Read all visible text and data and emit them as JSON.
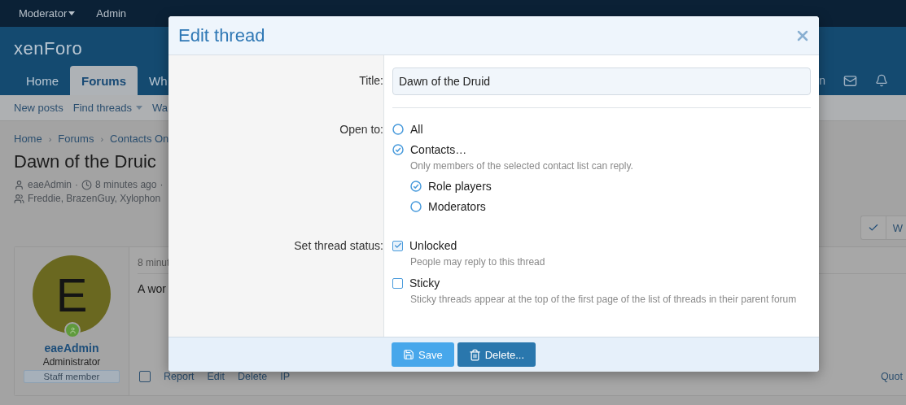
{
  "top_bar": {
    "items": [
      {
        "label": "Moderator",
        "dropdown": true
      },
      {
        "label": "Admin",
        "dropdown": false
      }
    ]
  },
  "header": {
    "logo": "xenForo",
    "tabs": [
      {
        "label": "Home",
        "selected": false
      },
      {
        "label": "Forums",
        "selected": true
      },
      {
        "label": "Wh",
        "selected": false
      }
    ],
    "right_label": "n"
  },
  "sub_nav": [
    {
      "label": "New posts",
      "dropdown": false
    },
    {
      "label": "Find threads",
      "dropdown": true
    },
    {
      "label": "Wa",
      "dropdown": false
    }
  ],
  "breadcrumb": {
    "separator": "›",
    "items": [
      "Home",
      "Forums",
      "Contacts On"
    ]
  },
  "thread": {
    "title": "Dawn of the Druic",
    "author": "eaeAdmin",
    "separator": "·",
    "time": "8 minutes ago",
    "trailing": "·",
    "participants": "Freddie, BrazenGuy, Xylophon",
    "action_label": "W"
  },
  "post": {
    "selected": false,
    "avatar_letter": "E",
    "username": "eaeAdmin",
    "role": "Administrator",
    "badge": "Staff member",
    "time": "8 minut",
    "body": "A wor",
    "actions": [
      "Report",
      "Edit",
      "Delete",
      "IP"
    ],
    "right_action": "Quot"
  },
  "modal": {
    "title": "Edit thread",
    "fields": [
      {
        "kind": "text",
        "label": "Title:",
        "value": "Dawn of the Druid"
      },
      {
        "kind": "radio",
        "label": "Open to:",
        "options": [
          {
            "label": "All",
            "selected": false
          },
          {
            "label": "Contacts…",
            "selected": true,
            "hint": "Only members of the selected contact list can reply.",
            "children": [
              {
                "label": "Role players",
                "selected": true
              },
              {
                "label": "Moderators",
                "selected": false
              }
            ]
          }
        ]
      },
      {
        "kind": "checkbox",
        "label": "Set thread status:",
        "options": [
          {
            "label": "Unlocked",
            "checked": true,
            "hint": "People may reply to this thread"
          },
          {
            "label": "Sticky",
            "checked": false,
            "hint": "Sticky threads appear at the top of the first page of the list of threads in their parent forum"
          }
        ]
      }
    ],
    "buttons": [
      {
        "label": "Save",
        "kind": "primary"
      },
      {
        "label": "Delete...",
        "kind": "secondary"
      }
    ]
  }
}
